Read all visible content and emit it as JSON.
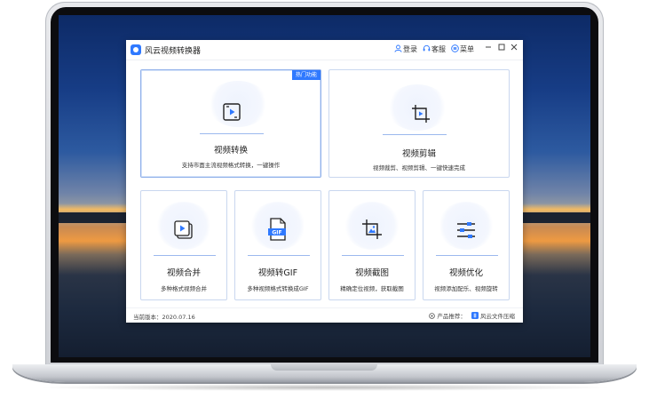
{
  "app": {
    "title": "风云视频转换器",
    "accent": "#2f79ff",
    "header": {
      "login": "登录",
      "service": "客服",
      "menu": "菜单"
    }
  },
  "cards": {
    "convert": {
      "title": "视频转换",
      "desc": "支持市面主流视频格式转换，一键操作",
      "badge": "热门功能",
      "icon": "video-convert-icon"
    },
    "edit": {
      "title": "视频剪辑",
      "desc": "视频裁剪、视频剪辑、一键快速完成",
      "icon": "crop-video-icon"
    },
    "merge": {
      "title": "视频合并",
      "desc": "多种格式视频合并",
      "icon": "video-merge-icon"
    },
    "gif": {
      "title": "视频转GIF",
      "desc": "多种视频格式转换成GIF",
      "icon": "gif-file-icon"
    },
    "screenshot": {
      "title": "视频截图",
      "desc": "精确定位视频，获取截图",
      "icon": "image-crop-icon"
    },
    "optimize": {
      "title": "视频优化",
      "desc": "视频添加配乐、视频旋转",
      "icon": "sliders-icon"
    }
  },
  "footer": {
    "version_label": "当前版本：2020.07.16",
    "recommend_label": "产品推荐：",
    "recommend_product": "风云文件压缩"
  }
}
